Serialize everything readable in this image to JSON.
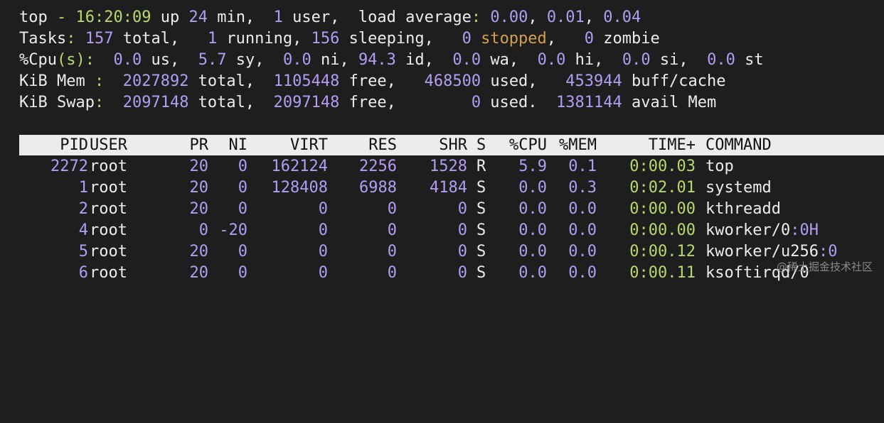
{
  "summary": {
    "top": {
      "prog": "top",
      "dash": " - ",
      "time": "16:20:09",
      "up_txt": " up ",
      "up_val": "24",
      "up_unit": " min,  ",
      "users": "1",
      "users_txt": " user,  load average",
      "colon": ":",
      "la1": "0.00",
      ",1": ", ",
      "la2": "0.01",
      ",2": ", ",
      "la3": "0.04"
    },
    "tasks": {
      "label": "Tasks",
      "colon": ":",
      "total": "157",
      "total_txt": " total,   ",
      "running": "1",
      "running_txt": " running, ",
      "sleeping": "156",
      "sleeping_txt": " sleeping,   ",
      "stopped": "0",
      "stopped_txt": " stopped",
      "comma": ",   ",
      "zombie": "0",
      "zombie_txt": " zombie"
    },
    "cpu": {
      "label": "%Cpu",
      "paren": "(s)",
      "colon": ": ",
      "us": "0.0",
      "us_txt": " us,  ",
      "sy": "5.7",
      "sy_txt": " sy,  ",
      "ni": "0.0",
      "ni_txt": " ni, ",
      "id": "94.3",
      "id_txt": " id,  ",
      "wa": "0.0",
      "wa_txt": " wa,  ",
      "hi": "0.0",
      "hi_txt": " hi,  ",
      "si": "0.0",
      "si_txt": " si,  ",
      "st": "0.0",
      "st_txt": " st"
    },
    "mem": {
      "label": "KiB Mem ",
      "colon": ": ",
      "total": "2027892",
      "total_txt": " total,  ",
      "free": "1105448",
      "free_txt": " free,   ",
      "used": "468500",
      "used_txt": " used,   ",
      "buff": "453944",
      "buff_txt": " buff/cache"
    },
    "swap": {
      "label": "KiB Swap",
      "colon": ": ",
      "total": "2097148",
      "total_txt": " total,  ",
      "free": "2097148",
      "free_txt": " free,        ",
      "used": "0",
      "used_txt": " used.  ",
      "avail": "1381144",
      "avail_txt": " avail Mem"
    }
  },
  "columns": [
    "PID",
    "USER",
    "PR",
    "NI",
    "VIRT",
    "RES",
    "SHR",
    "S",
    "%CPU",
    "%MEM",
    "TIME+",
    "COMMAND"
  ],
  "processes": [
    {
      "pid": "2272",
      "user": "root",
      "pr": "20",
      "ni": "0",
      "virt": "162124",
      "res": "2256",
      "shr": "1528",
      "s": "R",
      "cpu": "5.9",
      "mem": "0.1",
      "time": "0:00.03",
      "cmd": "top",
      "cmd_tail": ""
    },
    {
      "pid": "1",
      "user": "root",
      "pr": "20",
      "ni": "0",
      "virt": "128408",
      "res": "6988",
      "shr": "4184",
      "s": "S",
      "cpu": "0.0",
      "mem": "0.3",
      "time": "0:02.01",
      "cmd": "systemd",
      "cmd_tail": ""
    },
    {
      "pid": "2",
      "user": "root",
      "pr": "20",
      "ni": "0",
      "virt": "0",
      "res": "0",
      "shr": "0",
      "s": "S",
      "cpu": "0.0",
      "mem": "0.0",
      "time": "0:00.00",
      "cmd": "kthreadd",
      "cmd_tail": ""
    },
    {
      "pid": "4",
      "user": "root",
      "pr": "0",
      "ni": "-20",
      "virt": "0",
      "res": "0",
      "shr": "0",
      "s": "S",
      "cpu": "0.0",
      "mem": "0.0",
      "time": "0:00.00",
      "cmd": "kworker/0",
      "cmd_tail": ":0H"
    },
    {
      "pid": "5",
      "user": "root",
      "pr": "20",
      "ni": "0",
      "virt": "0",
      "res": "0",
      "shr": "0",
      "s": "S",
      "cpu": "0.0",
      "mem": "0.0",
      "time": "0:00.12",
      "cmd": "kworker/u256",
      "cmd_tail": ":0"
    },
    {
      "pid": "6",
      "user": "root",
      "pr": "20",
      "ni": "0",
      "virt": "0",
      "res": "0",
      "shr": "0",
      "s": "S",
      "cpu": "0.0",
      "mem": "0.0",
      "time": "0:00.11",
      "cmd": "ksoftirqd/0",
      "cmd_tail": ""
    }
  ],
  "watermark": "@稀土掘金技术社区"
}
